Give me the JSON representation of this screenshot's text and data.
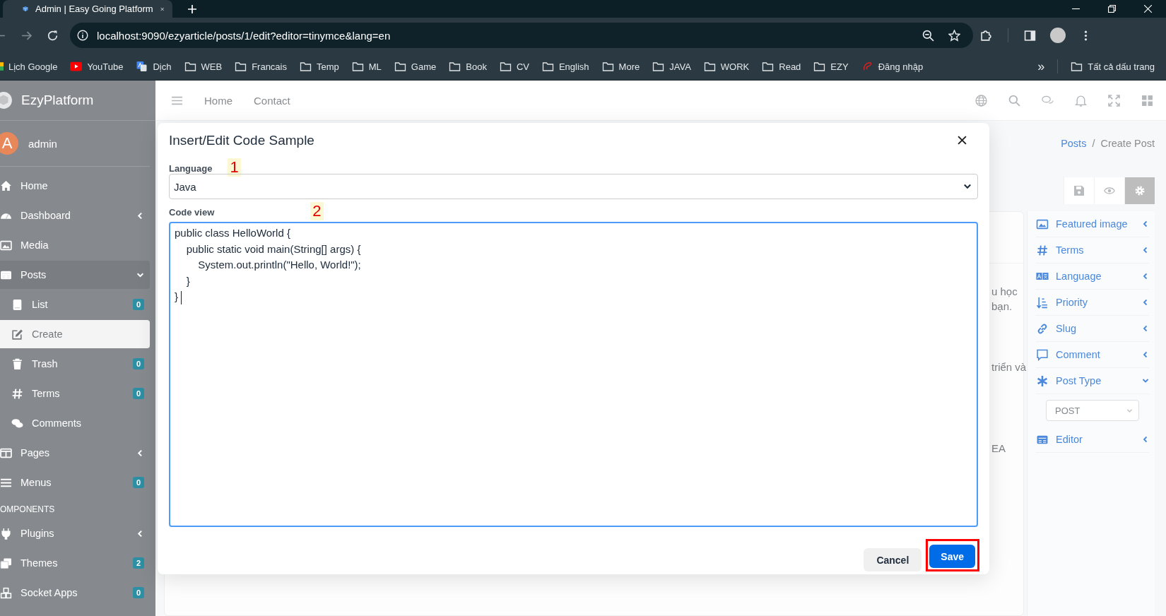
{
  "browser": {
    "tab_title": "Admin | Easy Going Platform",
    "url": "localhost:9090/ezyarticle/posts/1/edit?editor=tinymce&lang=en",
    "overflow": "»",
    "all_bookmarks": "Tất cả dấu trang",
    "bookmarks": [
      {
        "label": "Lịch Google",
        "kind": "calendar"
      },
      {
        "label": "YouTube",
        "kind": "video"
      },
      {
        "label": "Dịch",
        "kind": "translate"
      },
      {
        "label": "WEB",
        "kind": "folder"
      },
      {
        "label": "Francais",
        "kind": "folder"
      },
      {
        "label": "Temp",
        "kind": "folder"
      },
      {
        "label": "ML",
        "kind": "folder"
      },
      {
        "label": "Game",
        "kind": "folder"
      },
      {
        "label": "Book",
        "kind": "folder"
      },
      {
        "label": "CV",
        "kind": "folder"
      },
      {
        "label": "English",
        "kind": "folder"
      },
      {
        "label": "More",
        "kind": "folder"
      },
      {
        "label": "JAVA",
        "kind": "folder"
      },
      {
        "label": "WORK",
        "kind": "folder"
      },
      {
        "label": "Read",
        "kind": "folder"
      },
      {
        "label": "EZY",
        "kind": "folder"
      },
      {
        "label": "Đăng nhập",
        "kind": "site"
      }
    ]
  },
  "sidebar": {
    "brand": "EzyPlatform",
    "user": {
      "initial": "A",
      "name": "admin"
    },
    "items": [
      {
        "kind": "item",
        "label": "Home",
        "selected": false
      },
      {
        "kind": "item",
        "label": "Dashboard",
        "selected": false,
        "expanded": false
      },
      {
        "kind": "item",
        "label": "Media",
        "selected": false
      },
      {
        "kind": "item",
        "label": "Posts",
        "selected": false,
        "expanded": true,
        "children": [
          {
            "label": "List",
            "badge": "0",
            "selected": false
          },
          {
            "label": "Create",
            "selected": true
          },
          {
            "label": "Trash",
            "badge": "0",
            "selected": false
          },
          {
            "label": "Terms",
            "badge": "0",
            "selected": false
          },
          {
            "label": "Comments",
            "selected": false
          }
        ]
      },
      {
        "kind": "item",
        "label": "Pages",
        "selected": false,
        "expanded": false
      },
      {
        "kind": "item",
        "label": "Menus",
        "badge": "0",
        "selected": false
      },
      {
        "kind": "header",
        "label": "OMPONENTS"
      },
      {
        "kind": "item",
        "label": "Plugins",
        "selected": false,
        "expanded": false
      },
      {
        "kind": "item",
        "label": "Themes",
        "badge": "2",
        "selected": false
      },
      {
        "kind": "item",
        "label": "Socket Apps",
        "badge": "0",
        "selected": false
      }
    ]
  },
  "topnav": {
    "links": [
      "Home",
      "Contact"
    ]
  },
  "breadcrumb": [
    "Posts",
    "/",
    "Create Post"
  ],
  "editor_fragments": [
    "u học",
    "bạn.",
    "triển và",
    "EA"
  ],
  "settings_panel": [
    {
      "label": "Featured image",
      "expanded": false
    },
    {
      "label": "Terms",
      "expanded": false
    },
    {
      "label": "Language",
      "expanded": false
    },
    {
      "label": "Priority",
      "expanded": false
    },
    {
      "label": "Slug",
      "expanded": false
    },
    {
      "label": "Comment",
      "expanded": false
    },
    {
      "label": "Post Type",
      "expanded": true,
      "select": "POST"
    },
    {
      "label": "Editor",
      "expanded": false
    }
  ],
  "dialog": {
    "title": "Insert/Edit Code Sample",
    "language_label": "Language",
    "language": "Java",
    "code_label": "Code view",
    "code": [
      "public class HelloWorld {",
      "    public static void main(String[] args) {",
      "        System.out.println(\"Hello, World!\");",
      "    }",
      "}"
    ],
    "buttons": [
      "Cancel",
      "Save"
    ]
  },
  "annotations": [
    "1",
    "2"
  ]
}
